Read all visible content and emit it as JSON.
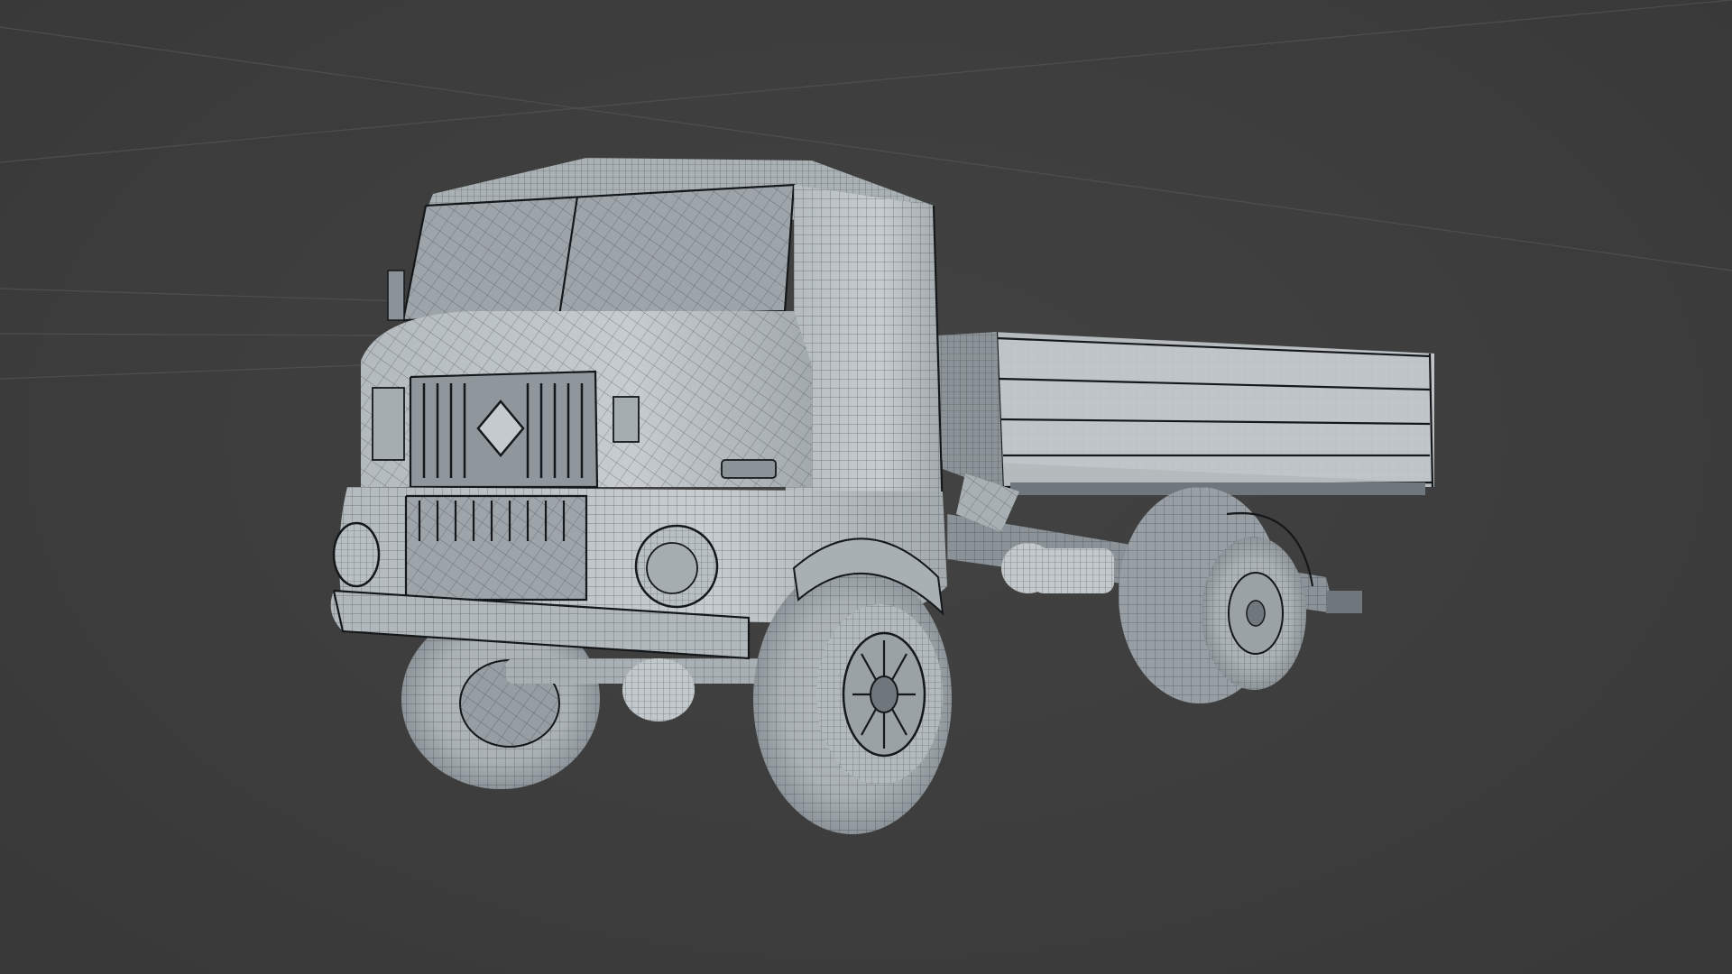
{
  "viewport": {
    "mode": "wireframe-overlay",
    "background_color": "#3d3d3d",
    "mesh_color": "#c2c8cb",
    "edge_color": "#1f2326"
  },
  "scene": {
    "objects": [
      {
        "icon": "truck-model-icon"
      }
    ]
  }
}
